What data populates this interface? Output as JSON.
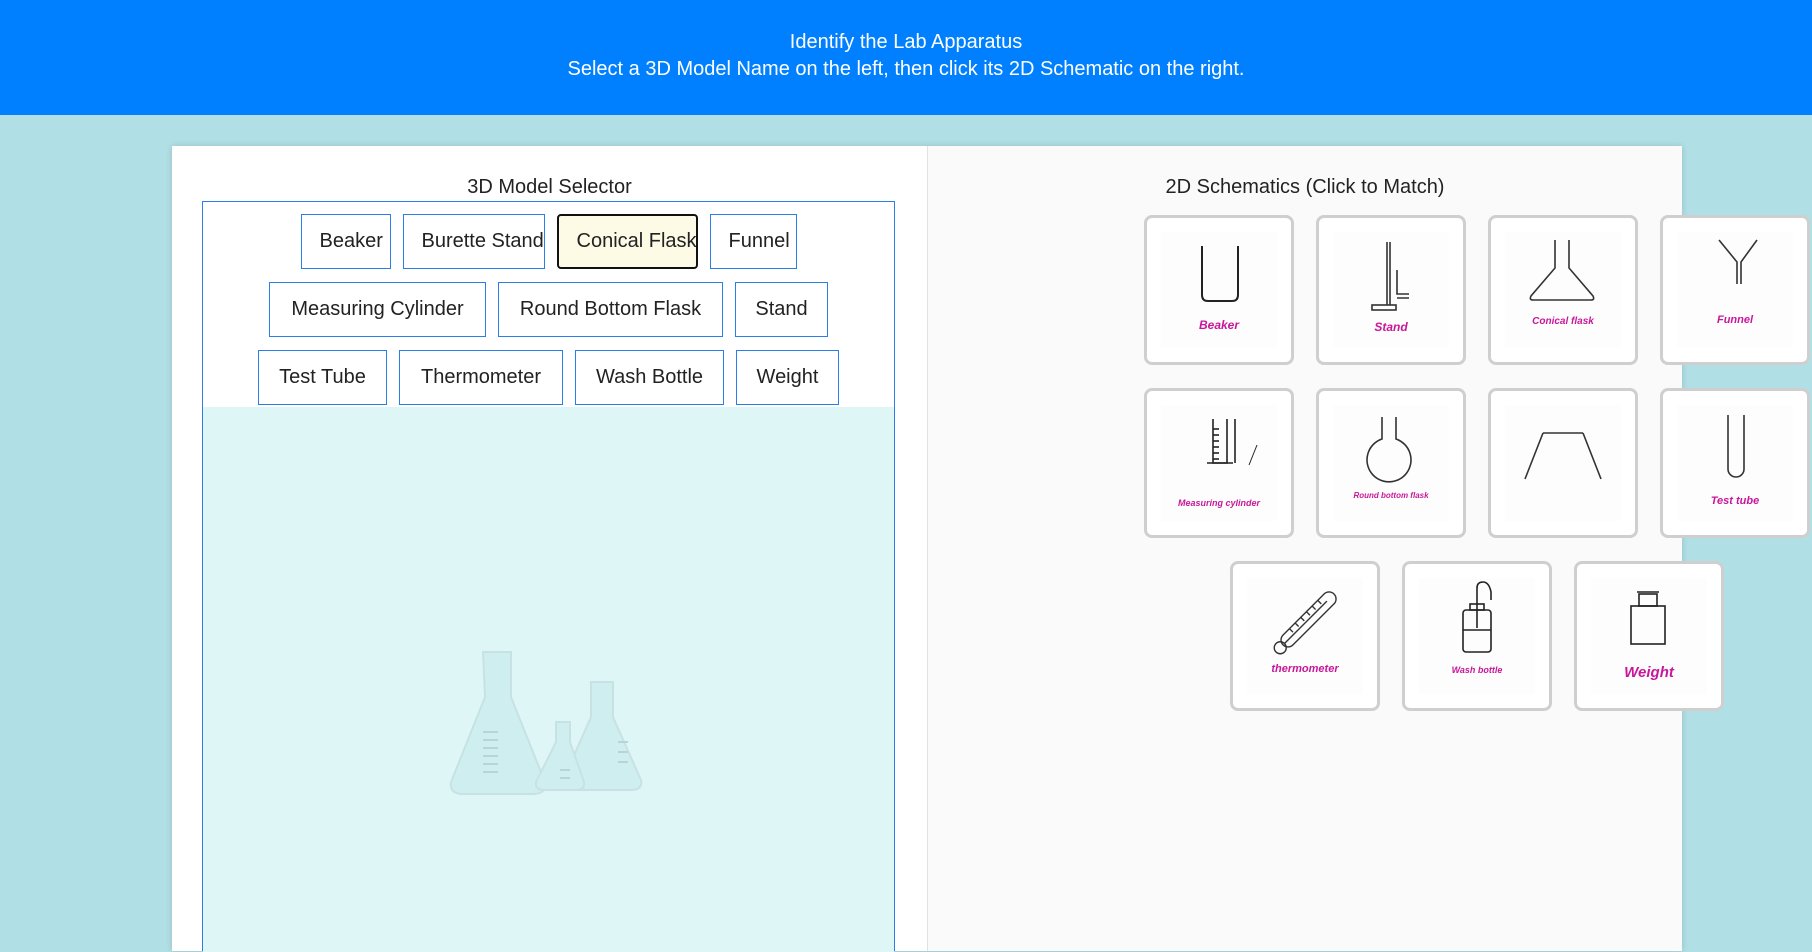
{
  "header": {
    "title": "Identify the Lab Apparatus",
    "subtitle": "Select a 3D Model Name on the left, then click its 2D Schematic on the right."
  },
  "left_panel": {
    "title": "3D Model Selector",
    "buttons": [
      "Beaker",
      "Burette Stand",
      "Conical Flask",
      "Funnel",
      "Measuring Cylinder",
      "Round Bottom Flask",
      "Stand",
      "Test Tube",
      "Thermometer",
      "Wash Bottle",
      "Weight"
    ],
    "selected": "Conical Flask"
  },
  "right_panel": {
    "title": "2D Schematics (Click to Match)",
    "cards": [
      {
        "caption": "Beaker",
        "icon": "beaker-icon"
      },
      {
        "caption": "Stand",
        "icon": "burette-stand-icon"
      },
      {
        "caption": "Conical flask",
        "icon": "conical-flask-icon"
      },
      {
        "caption": "Funnel",
        "icon": "funnel-icon"
      },
      {
        "caption": "Measuring cylinder",
        "icon": "measuring-cylinder-icon"
      },
      {
        "caption": "Round bottom flask",
        "icon": "round-bottom-flask-icon"
      },
      {
        "caption": "",
        "icon": "tripod-stand-icon"
      },
      {
        "caption": "Test tube",
        "icon": "test-tube-icon"
      },
      {
        "caption": "thermometer",
        "icon": "thermometer-icon"
      },
      {
        "caption": "Wash bottle",
        "icon": "wash-bottle-icon"
      },
      {
        "caption": "Weight",
        "icon": "weight-icon"
      }
    ]
  },
  "colors": {
    "header_bg": "#0080ff",
    "page_bg": "#b0dfe5",
    "button_border": "#2a7ee8",
    "selected_bg": "#fdfae6",
    "caption": "#c8179a",
    "viewer_bg": "#dff6f7"
  }
}
